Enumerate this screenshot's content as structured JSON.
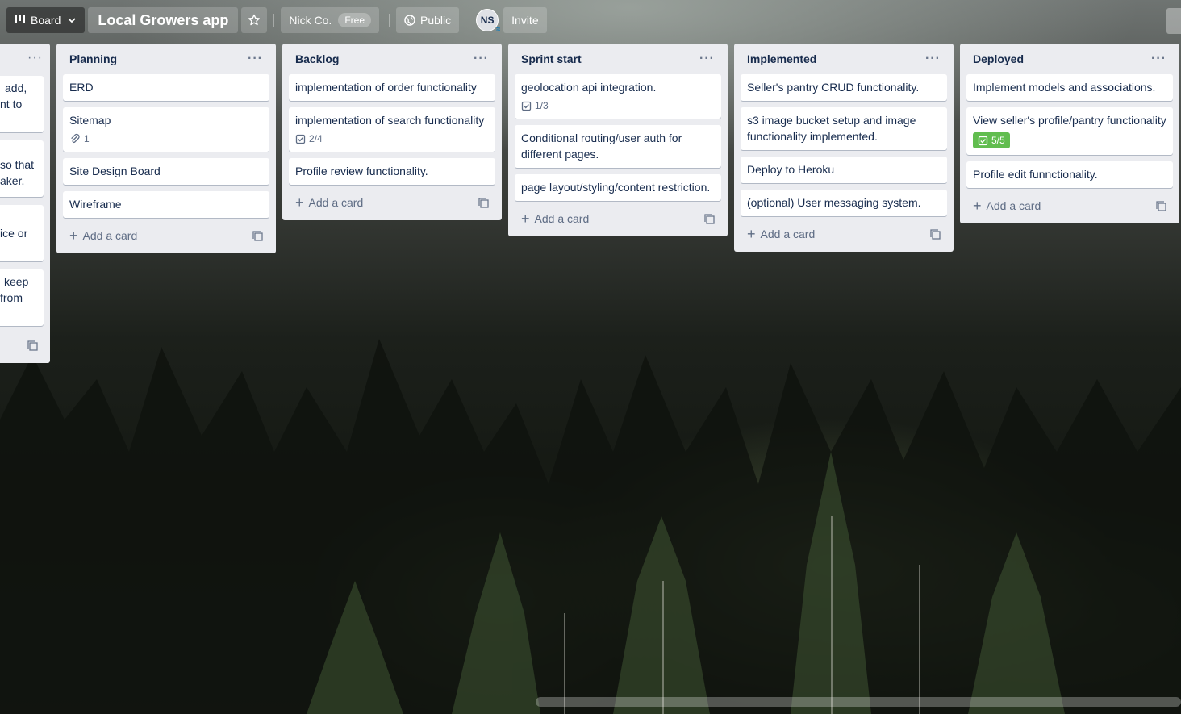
{
  "header": {
    "view_label": "Board",
    "title": "Local Growers app",
    "workspace": "Nick Co.",
    "workspace_badge": "Free",
    "visibility": "Public",
    "avatar_initials": "NS",
    "invite_label": "Invite"
  },
  "partial_list": {
    "cards": [
      {
        "lines": [
          "add,",
          "nt to"
        ]
      },
      {
        "lines": [
          "",
          "so that",
          "aker."
        ]
      },
      {
        "lines": [
          "ice or"
        ]
      },
      {
        "lines": [
          "keep",
          "from"
        ]
      }
    ]
  },
  "lists": [
    {
      "title": "Planning",
      "add_label": "Add a card",
      "cards": [
        {
          "title": "ERD"
        },
        {
          "title": "Sitemap",
          "attachments": "1"
        },
        {
          "title": "Site Design Board"
        },
        {
          "title": "Wireframe"
        }
      ]
    },
    {
      "title": "Backlog",
      "add_label": "Add a card",
      "cards": [
        {
          "title": "implementation of order functionality"
        },
        {
          "title": "implementation of search functionality",
          "checklist": "2/4"
        },
        {
          "title": "Profile review functionality."
        }
      ]
    },
    {
      "title": "Sprint start",
      "add_label": "Add a card",
      "cards": [
        {
          "title": "geolocation api integration.",
          "checklist": "1/3"
        },
        {
          "title": "Conditional routing/user auth for different pages."
        },
        {
          "title": "page layout/styling/content restriction."
        }
      ]
    },
    {
      "title": "Implemented",
      "add_label": "Add a card",
      "cards": [
        {
          "title": "Seller's pantry CRUD functionality."
        },
        {
          "title": "s3 image bucket setup and image functionality implemented."
        },
        {
          "title": "Deploy to Heroku"
        },
        {
          "title": "(optional) User messaging system."
        }
      ]
    },
    {
      "title": "Deployed",
      "add_label": "Add a card",
      "cards": [
        {
          "title": "Implement models and associations."
        },
        {
          "title": "View seller's profile/pantry functionality",
          "checklist_complete": "5/5"
        },
        {
          "title": "Profile edit funnctionality."
        }
      ]
    }
  ]
}
